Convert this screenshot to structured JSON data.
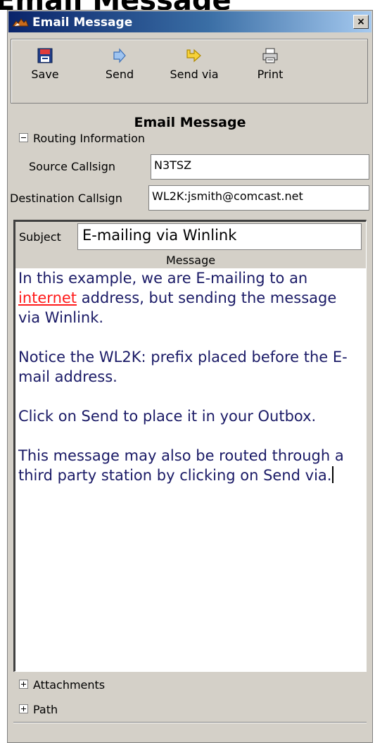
{
  "background_title": "Email Message",
  "window": {
    "title": "Email Message",
    "close_glyph": "×"
  },
  "toolbar": {
    "save_label": "Save",
    "send_label": "Send",
    "send_via_label": "Send via",
    "print_label": "Print"
  },
  "form": {
    "title": "Email Message",
    "routing_section": "Routing Information",
    "source_label": "Source Callsign",
    "source_value": "N3TSZ",
    "destination_label": "Destination Callsign",
    "destination_value": "WL2K:jsmith@comcast.net",
    "subject_label": "Subject",
    "subject_value": "E-mailing via Winlink",
    "message_header": "Message",
    "message": {
      "p1_a": "In this example, we are E-mailing to an ",
      "p1_link": "internet",
      "p1_b": " address, but sending the message via Winlink.",
      "p2": "Notice the WL2K: prefix placed before the E-mail address.",
      "p3": "Click on Send to place it in your Outbox.",
      "p4": "This message may also be routed through a third party station by clicking on Send via."
    },
    "attachments_section": "Attachments",
    "path_section": "Path"
  },
  "icons": {
    "save": "floppy-disk-icon",
    "send": "send-arrow-icon",
    "send_via": "send-via-arrow-icon",
    "print": "printer-icon",
    "app": "app-logo-icon"
  },
  "colors": {
    "titlebar_start": "#0a246a",
    "titlebar_end": "#a6caf0",
    "window_bg": "#d4d0c8",
    "link": "#ff1a1a",
    "message_text": "#1a1a66"
  }
}
